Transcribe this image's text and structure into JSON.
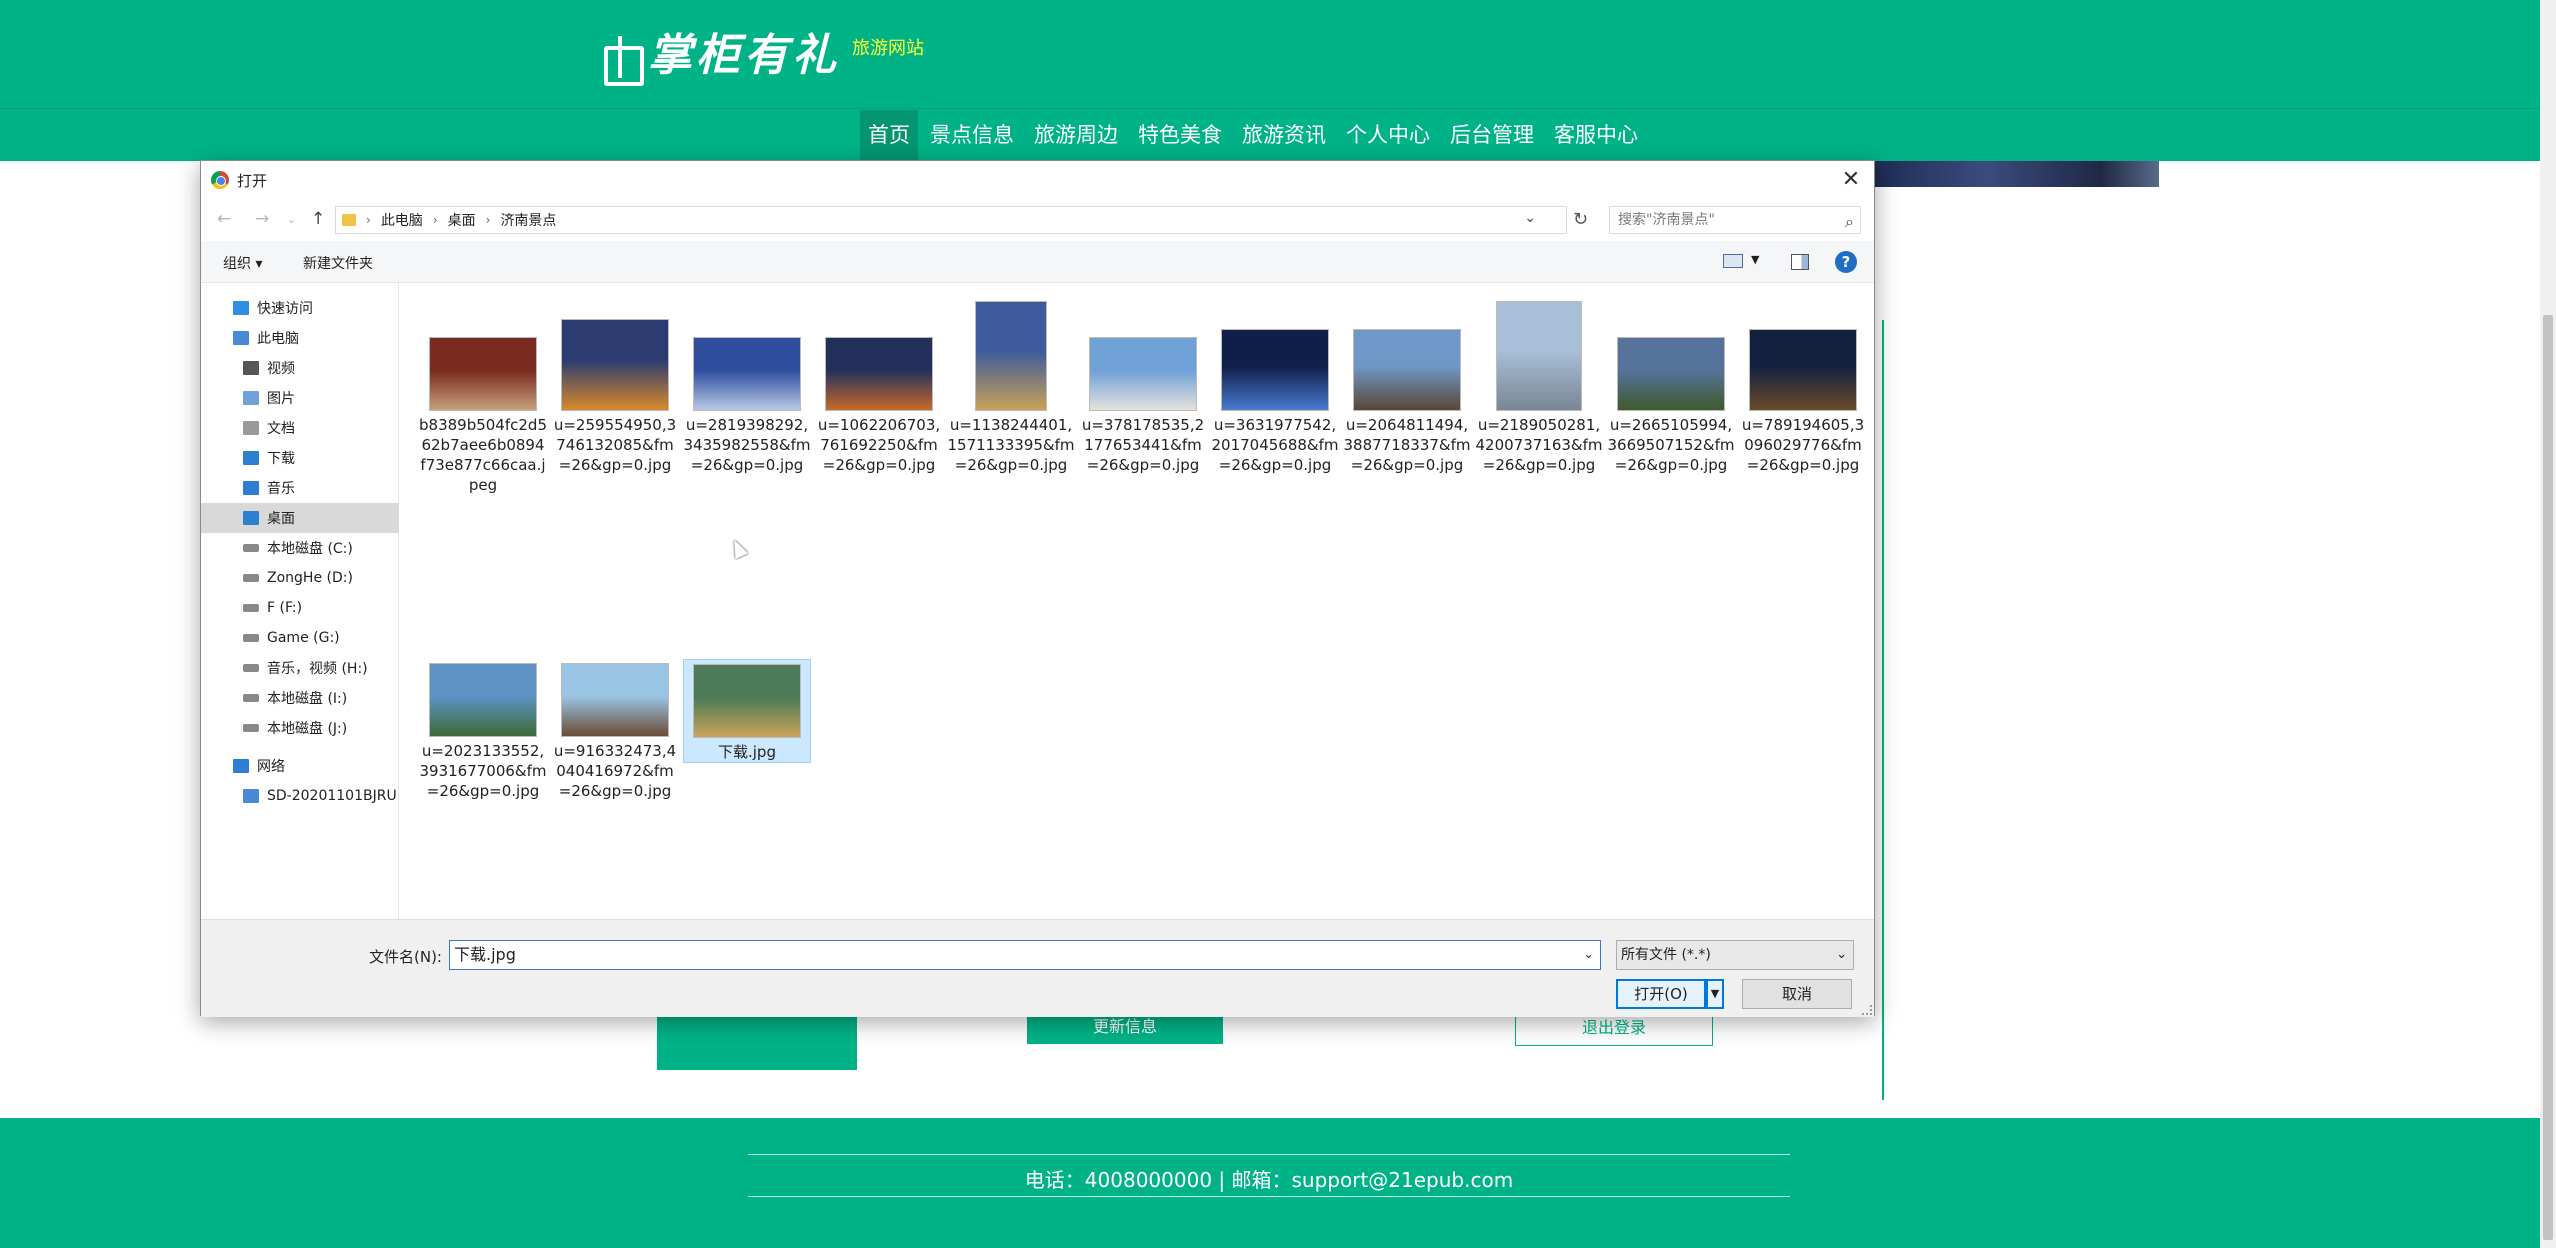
{
  "site": {
    "logo_text": "掌柜有礼",
    "logo_sub": "旅游网站",
    "nav": [
      "首页",
      "景点信息",
      "旅游周边",
      "特色美食",
      "旅游资讯",
      "个人中心",
      "后台管理",
      "客服中心"
    ],
    "update_button": "更新信息",
    "logout_button": "退出登录",
    "footer": "电话：4008000000 | 邮箱：support@21epub.com",
    "colors": {
      "brand": "#00b386",
      "logo_sub": "#ffff33"
    }
  },
  "dialog": {
    "title": "打开",
    "breadcrumb": [
      "此电脑",
      "桌面",
      "济南景点"
    ],
    "search_placeholder": "搜索\"济南景点\"",
    "toolbar": {
      "organize": "组织 ▾",
      "new_folder": "新建文件夹"
    },
    "sidebar": [
      {
        "label": "快速访问",
        "icon": "star-icon"
      },
      {
        "label": "此电脑",
        "icon": "computer-icon"
      },
      {
        "label": "视频",
        "icon": "video-icon"
      },
      {
        "label": "图片",
        "icon": "pictures-icon"
      },
      {
        "label": "文档",
        "icon": "documents-icon"
      },
      {
        "label": "下载",
        "icon": "download-icon"
      },
      {
        "label": "音乐",
        "icon": "music-icon"
      },
      {
        "label": "桌面",
        "icon": "desktop-icon"
      },
      {
        "label": "本地磁盘 (C:)",
        "icon": "drive-icon"
      },
      {
        "label": "ZongHe (D:)",
        "icon": "drive-icon"
      },
      {
        "label": "F (F:)",
        "icon": "drive-icon"
      },
      {
        "label": "Game (G:)",
        "icon": "drive-icon"
      },
      {
        "label": "音乐，视频 (H:)",
        "icon": "drive-icon"
      },
      {
        "label": "本地磁盘 (I:)",
        "icon": "drive-icon"
      },
      {
        "label": "本地磁盘 (J:)",
        "icon": "drive-icon"
      },
      {
        "label": "网络",
        "icon": "network-icon"
      },
      {
        "label": "SD-20201101BJRU",
        "icon": "network-computer-icon"
      }
    ],
    "files": [
      {
        "name": "b8389b504fc2d562b7aee6b0894f73e877c66caa.jpeg",
        "colors": [
          "#7a2a1f",
          "#c8a07a"
        ]
      },
      {
        "name": "u=259554950,3746132085&fm=26&gp=0.jpg",
        "colors": [
          "#2d3c70",
          "#d88a2b"
        ]
      },
      {
        "name": "u=2819398292,3435982558&fm=26&gp=0.jpg",
        "colors": [
          "#2f4f9e",
          "#b9c9e6"
        ]
      },
      {
        "name": "u=1062206703,761692250&fm=26&gp=0.jpg",
        "colors": [
          "#23305c",
          "#c76a2a"
        ]
      },
      {
        "name": "u=1138244401,1571133395&fm=26&gp=0.jpg",
        "colors": [
          "#3e5a9a",
          "#c9a25a"
        ]
      },
      {
        "name": "u=378178535,2177653441&fm=26&gp=0.jpg",
        "colors": [
          "#6fa0d6",
          "#e6e2dc"
        ]
      },
      {
        "name": "u=3631977542,2017045688&fm=26&gp=0.jpg",
        "colors": [
          "#0f1f4a",
          "#4a7ad0"
        ]
      },
      {
        "name": "u=2064811494,3887718337&fm=26&gp=0.jpg",
        "colors": [
          "#6e98c8",
          "#5a4636"
        ]
      },
      {
        "name": "u=2189050281,4200737163&fm=26&gp=0.jpg",
        "colors": [
          "#a8bfd8",
          "#7a8694"
        ]
      },
      {
        "name": "u=2665105994,3669507152&fm=26&gp=0.jpg",
        "colors": [
          "#55739a",
          "#3f5a2c"
        ]
      },
      {
        "name": "u=789194605,3096029776&fm=26&gp=0.jpg",
        "colors": [
          "#13213f",
          "#6b4a2a"
        ]
      },
      {
        "name": "u=2023133552,3931677006&fm=26&gp=0.jpg",
        "colors": [
          "#5e92c4",
          "#3d6a38"
        ]
      },
      {
        "name": "u=916332473,4040416972&fm=26&gp=0.jpg",
        "colors": [
          "#9ac4e4",
          "#6b4c36"
        ]
      },
      {
        "name": "下载.jpg",
        "colors": [
          "#4d7a58",
          "#c9a45a"
        ]
      }
    ],
    "filename_label": "文件名(N):",
    "filename_value": "下载.jpg",
    "filetype": "所有文件 (*.*)",
    "open_button": "打开(O)",
    "cancel_button": "取消"
  }
}
